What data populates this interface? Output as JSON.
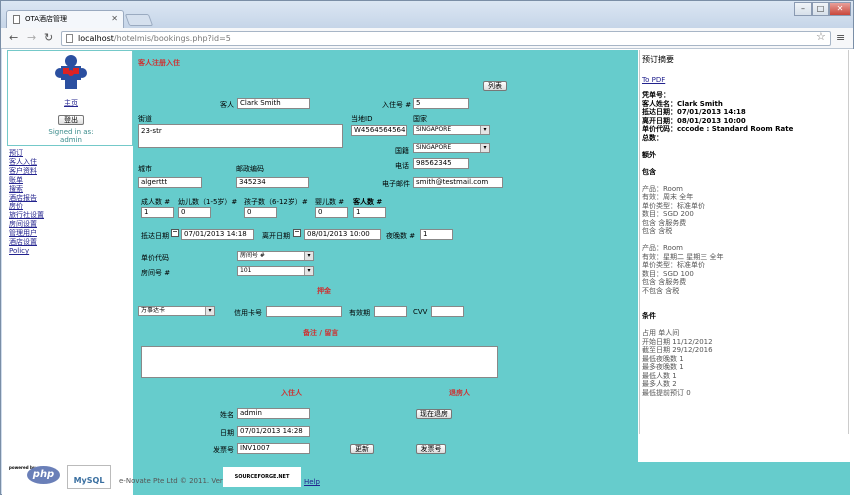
{
  "browser": {
    "tab_title": "OTA酒店管理",
    "url_host": "localhost",
    "url_path": "/hotelmis/bookings.php?id=5"
  },
  "sidebar": {
    "home": "主页",
    "logout": "登出",
    "signed_in_as": "Signed in as:",
    "user": "admin",
    "items": [
      "预订",
      "客人入住",
      "客户资料",
      "账单",
      "搜索",
      "酒店报告",
      "房价",
      "旅行社设置",
      "房间设置",
      "管理用户",
      "酒店设置",
      "Policy"
    ]
  },
  "form": {
    "title": "客人注册入住",
    "list_btn": "列表",
    "guest_label": "客人",
    "guest_value": "Clark  Smith",
    "checkin_no_label": "入住号 #",
    "checkin_no_value": "5",
    "street_label": "街道",
    "street_value": "23-str",
    "localid_label": "当地ID",
    "localid_value": "W45645645645",
    "country_label": "国家",
    "country_value": "SINGAPORE",
    "nationality_label": "国籍",
    "nationality_value": "SINGAPORE",
    "city_label": "城市",
    "city_value": "algerttt",
    "postcode_label": "邮政编码",
    "postcode_value": "345234",
    "phone_label": "电话",
    "phone_value": "98562345",
    "email_label": "电子邮件",
    "email_value": "smith@testmail.com",
    "adults_label": "成人数 #",
    "adults_value": "1",
    "infants_label": "幼儿数（1-5岁）#",
    "infants_value": "0",
    "children_label": "孩子数（6-12岁）#",
    "children_value": "0",
    "babies_label": "婴儿数 #",
    "babies_value": "0",
    "guests_label": "客人数 #",
    "guests_value": "1",
    "arrival_label": "抵达日期",
    "arrival_value": "07/01/2013 14:18",
    "departure_label": "离开日期",
    "departure_value": "08/01/2013 10:00",
    "nights_label": "夜晚数 #",
    "nights_value": "1",
    "rate_label": "单价代码",
    "rate_value": "房间号 #",
    "room_label": "房间号 #",
    "room_value": "101",
    "deposit_title": "押金",
    "card_type": "万事达卡",
    "card_no_label": "信用卡号",
    "expiry_label": "有效期",
    "cvv_label": "CVV",
    "remarks_title": "备注 / 留言",
    "checkin_person_title": "入住人",
    "checkout_person_title": "退房人",
    "name_label": "姓名",
    "name_value": "admin",
    "checkout_now_btn": "现在退房",
    "date_label": "日期",
    "date_value": "07/01/2013 14:28",
    "invoice_label": "发票号",
    "invoice_value": "INV1007",
    "update_btn": "更新",
    "invoice_btn": "发票号"
  },
  "summary": {
    "title": "预订摘要",
    "pdf": "To PDF",
    "lines": [
      {
        "t": "凭单号：",
        "c": "b"
      },
      {
        "t": "客人姓名：Clark Smith",
        "c": "b"
      },
      {
        "t": "抵达日期：07/01/2013 14:18",
        "c": "b"
      },
      {
        "t": "离开日期：08/01/2013 10:00",
        "c": "b"
      },
      {
        "t": "单价代码：cccode : Standard Room Rate",
        "c": "b"
      },
      {
        "t": "总数：",
        "c": "b"
      },
      {
        "t": "",
        "c": ""
      },
      {
        "t": "额外",
        "c": "b"
      },
      {
        "t": "",
        "c": ""
      },
      {
        "t": "包含",
        "c": "b"
      },
      {
        "t": "",
        "c": ""
      },
      {
        "t": "产品：Room",
        "c": "g"
      },
      {
        "t": "有效：周末 全年",
        "c": "g"
      },
      {
        "t": "单价类型：标准单价",
        "c": "g"
      },
      {
        "t": "数目：SGD 200",
        "c": "g"
      },
      {
        "t": "包含 含服务费",
        "c": "g"
      },
      {
        "t": "包含 含税",
        "c": "g"
      },
      {
        "t": "",
        "c": ""
      },
      {
        "t": "产品：Room",
        "c": "g"
      },
      {
        "t": "有效：星期二 星期三 全年",
        "c": "g"
      },
      {
        "t": "单价类型：标准单价",
        "c": "g"
      },
      {
        "t": "数目：SGD 100",
        "c": "g"
      },
      {
        "t": "包含 含服务费",
        "c": "g"
      },
      {
        "t": "不包含 含税",
        "c": "g"
      },
      {
        "t": "",
        "c": ""
      },
      {
        "t": "",
        "c": ""
      },
      {
        "t": "条件",
        "c": "b"
      },
      {
        "t": "",
        "c": ""
      },
      {
        "t": "占用 单人间",
        "c": "g"
      },
      {
        "t": "开始日期 11/12/2012",
        "c": "g"
      },
      {
        "t": "截至日期 29/12/2016",
        "c": "g"
      },
      {
        "t": "最低夜晚数 1",
        "c": "g"
      },
      {
        "t": "最多夜晚数 1",
        "c": "g"
      },
      {
        "t": "最低人数 1",
        "c": "g"
      },
      {
        "t": "最多人数 2",
        "c": "g"
      },
      {
        "t": "最低提前预订 0",
        "c": "g"
      }
    ]
  },
  "footer": {
    "powered": "powered by",
    "php": "php",
    "mysql": "MySQL",
    "copyright": "e-Novate Pte Ltd © 2011. Vers 1.1",
    "sf": "SOURCEFORGE.NET",
    "help": "Help"
  }
}
